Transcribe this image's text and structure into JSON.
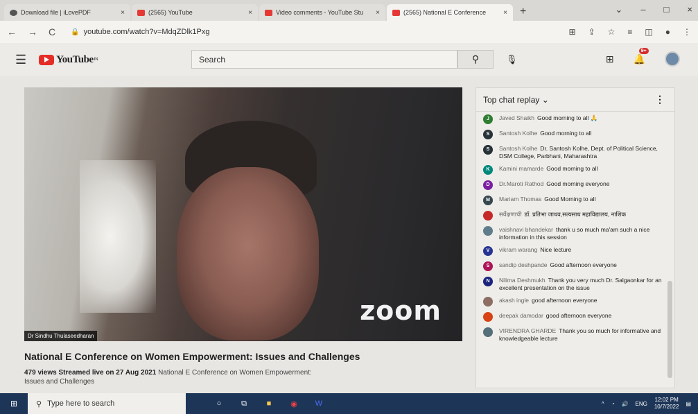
{
  "browser": {
    "tabs": [
      {
        "title": "Download file | iLovePDF",
        "close": "×",
        "favicon": "dark"
      },
      {
        "title": "(2565) YouTube",
        "close": "×",
        "favicon": "red"
      },
      {
        "title": "Video comments - YouTube Stu",
        "close": "×",
        "favicon": "red"
      },
      {
        "title": "(2565) National E Conference",
        "close": "×",
        "favicon": "red"
      }
    ],
    "new_tab": "+",
    "window_controls": [
      "⌄",
      "–",
      "□",
      "×"
    ],
    "url": "youtube.com/watch?v=MdqZDlk1Pxg"
  },
  "yt_header": {
    "logo_text": "YouTube",
    "logo_country": "IN",
    "search_placeholder": "Search",
    "notification_count": "9+"
  },
  "video": {
    "watermark": "zoom",
    "speaker_label": "Dr Sindhu Thulaseedharan"
  },
  "video_title": "National E Conference on Women Empowerment: Issues and Challenges",
  "video_meta": {
    "views": "479 views",
    "streamed": "Streamed live on 27 Aug 2021",
    "description": "National E Conference on Women Empowerment: Issues and Challenges"
  },
  "chat": {
    "header": "Top chat replay",
    "messages": [
      {
        "initial": "J",
        "color": "#2e7d32",
        "author": "Javed Shaikh",
        "text": "Good morning to all 🙏"
      },
      {
        "initial": "S",
        "color": "#263238",
        "author": "Santosh Kolhe",
        "text": "Good morning to all"
      },
      {
        "initial": "S",
        "color": "#263238",
        "author": "Santosh Kolhe",
        "text": "Dr. Santosh Kolhe, Dept. of Political Science, DSM College, Parbhani, Maharashtra"
      },
      {
        "initial": "K",
        "color": "#00897b",
        "author": "Kamini mamarde",
        "text": "Good morning to all"
      },
      {
        "initial": "D",
        "color": "#7b1fa2",
        "author": "Dr.Maroti Rathod",
        "text": "Good morning everyone"
      },
      {
        "initial": "M",
        "color": "#37474f",
        "author": "Mariam Thomas",
        "text": "Good Morning to all"
      },
      {
        "initial": "",
        "color": "#c62828",
        "author": "सर्वेक्षणाची",
        "text": "डॉ. प्रतिभा जाधव,सत्यसाध महाविद्यालय, नाशिक"
      },
      {
        "initial": "",
        "color": "#607d8b",
        "author": "vaishnavi bhandekar",
        "text": "thank u so much ma'am such a nice information in this session"
      },
      {
        "initial": "V",
        "color": "#283593",
        "author": "vikram warang",
        "text": "Nice lecture"
      },
      {
        "initial": "S",
        "color": "#ad1457",
        "author": "sandip deshpande",
        "text": "Good afternoon everyone"
      },
      {
        "initial": "N",
        "color": "#1a237e",
        "author": "Nilima Deshmukh",
        "text": "Thank you very much Dr. Salgaonkar for an excellent presentation on the issue"
      },
      {
        "initial": "",
        "color": "#8d6e63",
        "author": "akash ingle",
        "text": "good afternoon everyone"
      },
      {
        "initial": "",
        "color": "#d84315",
        "author": "deepak damodar",
        "text": "good afternoon everyone"
      },
      {
        "initial": "",
        "color": "#546e7a",
        "author": "VIRENDRA GHARDE",
        "text": "Thank you so much for informative and knowledgeable lecture"
      }
    ]
  },
  "taskbar": {
    "search_placeholder": "Type here to search",
    "lang": "ENG",
    "time": "12:02 PM",
    "date": "10/7/2022"
  }
}
